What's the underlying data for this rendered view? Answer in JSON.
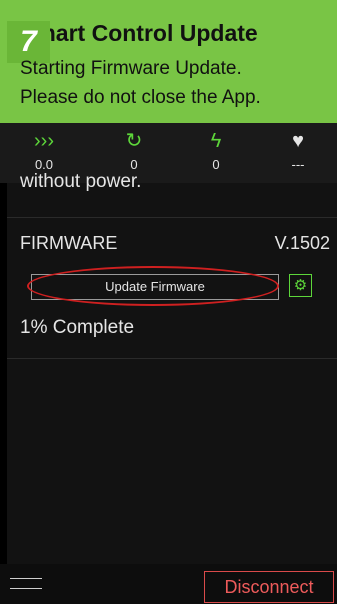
{
  "banner": {
    "step": "7",
    "title": "Smart Control Update",
    "message_line1": "Starting Firmware Update.",
    "message_line2": "Please do not close the App.",
    "background": "#79c545"
  },
  "stats": [
    {
      "icon": "speed-chevrons-icon",
      "glyph": "›››",
      "value": "0.0"
    },
    {
      "icon": "refresh-icon",
      "glyph": "↻",
      "value": "0"
    },
    {
      "icon": "lightning-icon",
      "glyph": "ϟ",
      "value": "0"
    },
    {
      "icon": "heart-icon",
      "glyph": "♥",
      "value": "---"
    }
  ],
  "content": {
    "partial_text": "without power.",
    "firmware": {
      "title": "FIRMWARE",
      "version": "V.1502",
      "button_label": "Update Firmware",
      "settings_icon": "gear-icon",
      "progress_text": "1% Complete"
    }
  },
  "bottombar": {
    "menu_icon": "hamburger-icon",
    "disconnect_label": "Disconnect",
    "accent": "#ee5b5b"
  }
}
